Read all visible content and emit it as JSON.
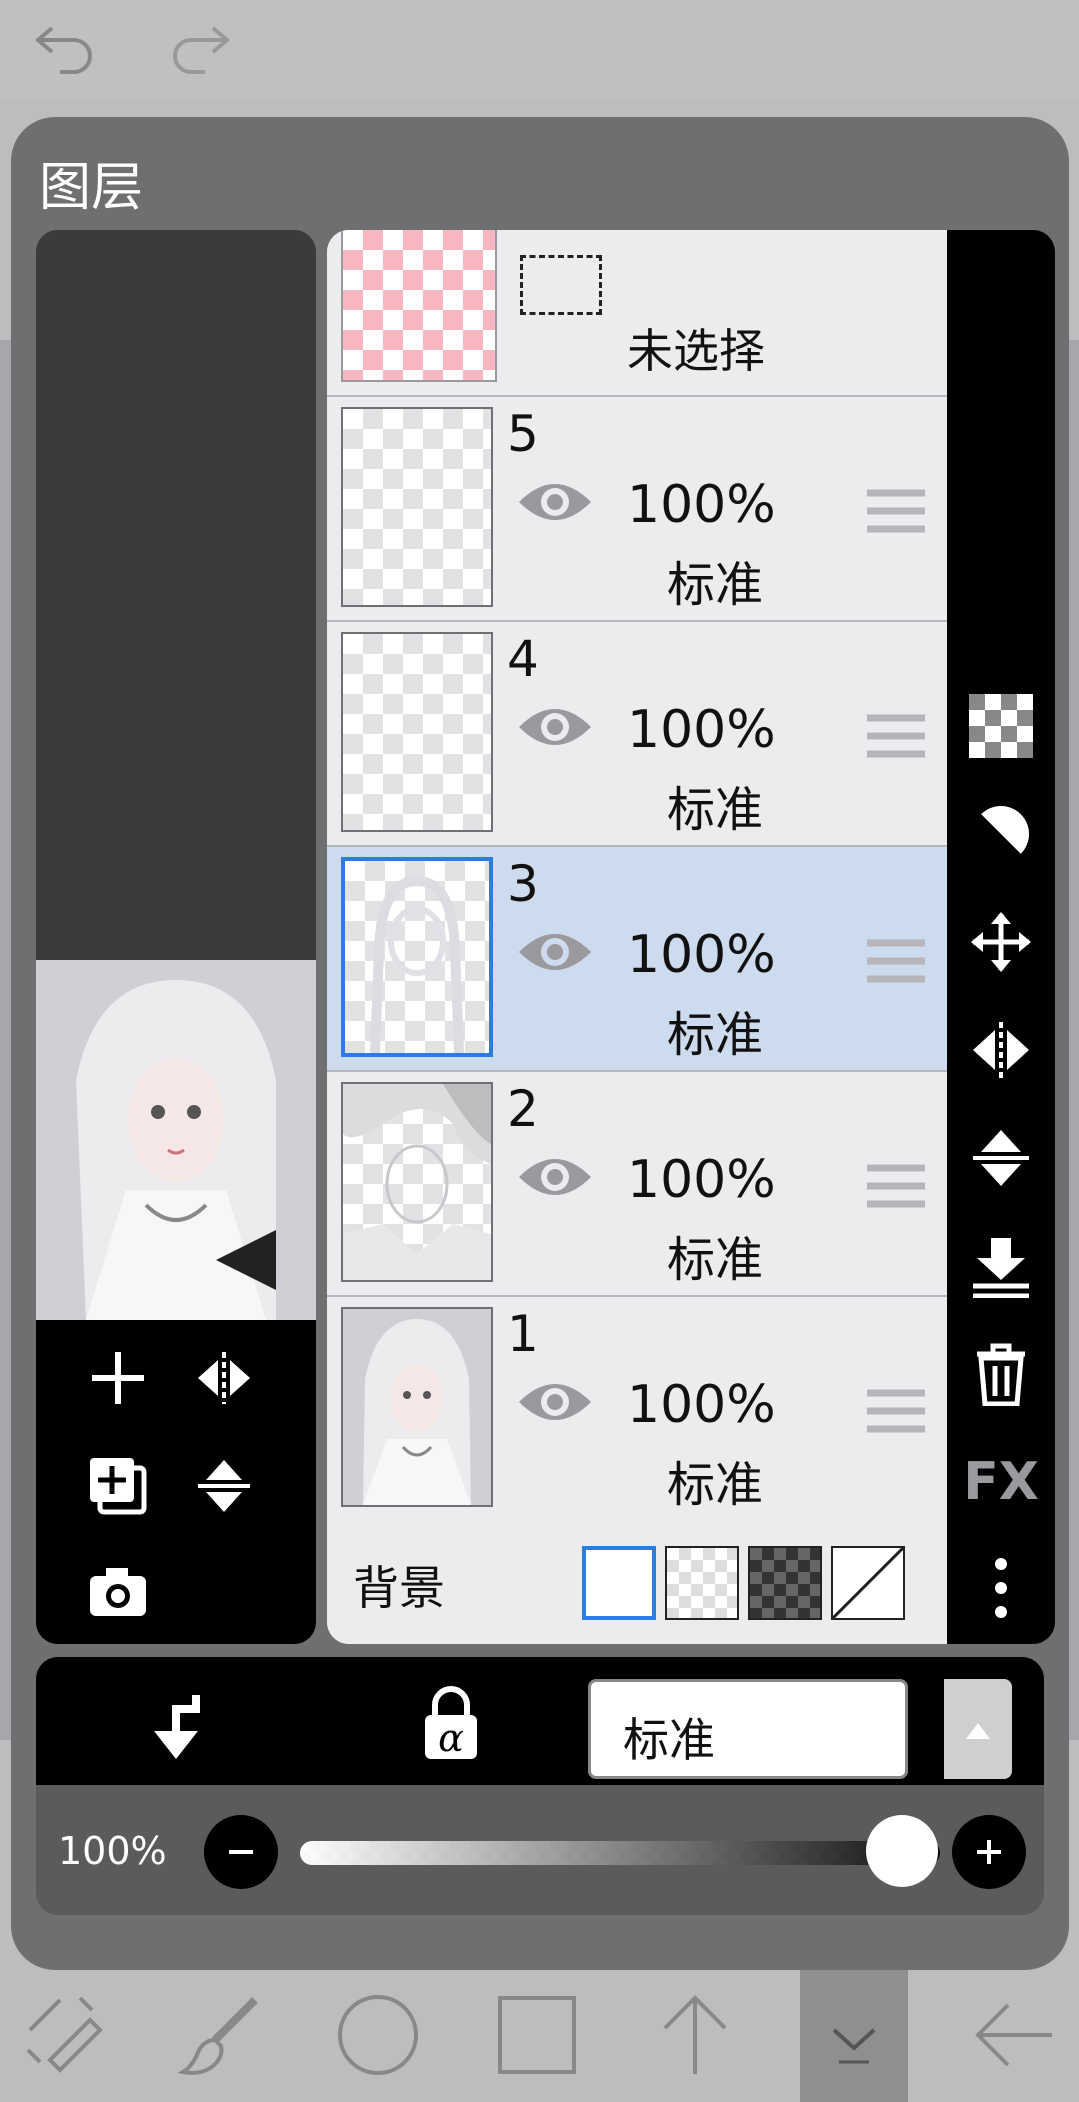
{
  "app": {
    "panel_title": "图层"
  },
  "topbar": {
    "undo_icon": "undo-icon",
    "redo_icon": "redo-icon"
  },
  "selection_layer": {
    "label": "未选择"
  },
  "layers": [
    {
      "number": "5",
      "opacity": "100%",
      "blend": "标准",
      "selected": false
    },
    {
      "number": "4",
      "opacity": "100%",
      "blend": "标准",
      "selected": false
    },
    {
      "number": "3",
      "opacity": "100%",
      "blend": "标准",
      "selected": true
    },
    {
      "number": "2",
      "opacity": "100%",
      "blend": "标准",
      "selected": false
    },
    {
      "number": "1",
      "opacity": "100%",
      "blend": "标准",
      "selected": false
    }
  ],
  "background": {
    "label": "背景",
    "options": [
      "white",
      "transparent-light",
      "transparent-dark",
      "none"
    ],
    "selected": "white"
  },
  "sidebar_tools": [
    "checker-icon",
    "invert-icon",
    "move-icon",
    "flip-horizontal-icon",
    "flip-vertical-icon",
    "merge-down-icon",
    "trash-icon",
    "fx-icon",
    "more-icon"
  ],
  "sidebar": {
    "fx_label": "FX"
  },
  "preview_tools": [
    "add-layer-icon",
    "flip-horizontal-icon",
    "duplicate-layer-icon",
    "flip-vertical-icon",
    "camera-icon"
  ],
  "blend_mode": {
    "value": "标准"
  },
  "opacity": {
    "label": "100%",
    "value": 1.0
  },
  "bottom_toolbar": [
    "transform-icon",
    "brush-icon",
    "circle-icon",
    "square-icon",
    "up-arrow-icon",
    "collapse-icon",
    "back-arrow-icon"
  ],
  "colors": {
    "selected_border": "#2b7de0",
    "selected_row": "#cddbef",
    "panel": "#6f6f71"
  }
}
